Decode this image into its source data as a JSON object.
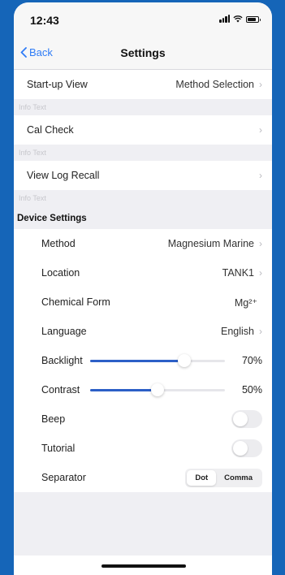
{
  "status": {
    "time": "12:43"
  },
  "nav": {
    "back_label": "Back",
    "title": "Settings"
  },
  "rows": {
    "startup_label": "Start-up View",
    "startup_value": "Method Selection",
    "info1": "Info Text",
    "calcheck_label": "Cal Check",
    "info2": "Info Text",
    "logrecall_label": "View Log Recall",
    "info3": "Info Text"
  },
  "device": {
    "header": "Device Settings",
    "method_label": "Method",
    "method_value": "Magnesium Marine",
    "location_label": "Location",
    "location_value": "TANK1",
    "chemform_label": "Chemical Form",
    "chemform_value": "Mg²⁺",
    "language_label": "Language",
    "language_value": "English",
    "backlight_label": "Backlight",
    "backlight_value": "70%",
    "backlight_level": 0.7,
    "contrast_label": "Contrast",
    "contrast_value": "50%",
    "contrast_level": 0.5,
    "beep_label": "Beep",
    "beep_on": false,
    "tutorial_label": "Tutorial",
    "tutorial_on": false,
    "separator_label": "Separator",
    "separator_options": [
      "Dot",
      "Comma"
    ],
    "separator_selected": "Dot"
  },
  "colors": {
    "accent": "#2f7cf6",
    "slider": "#2c5fc7",
    "background": "#1565b8"
  }
}
